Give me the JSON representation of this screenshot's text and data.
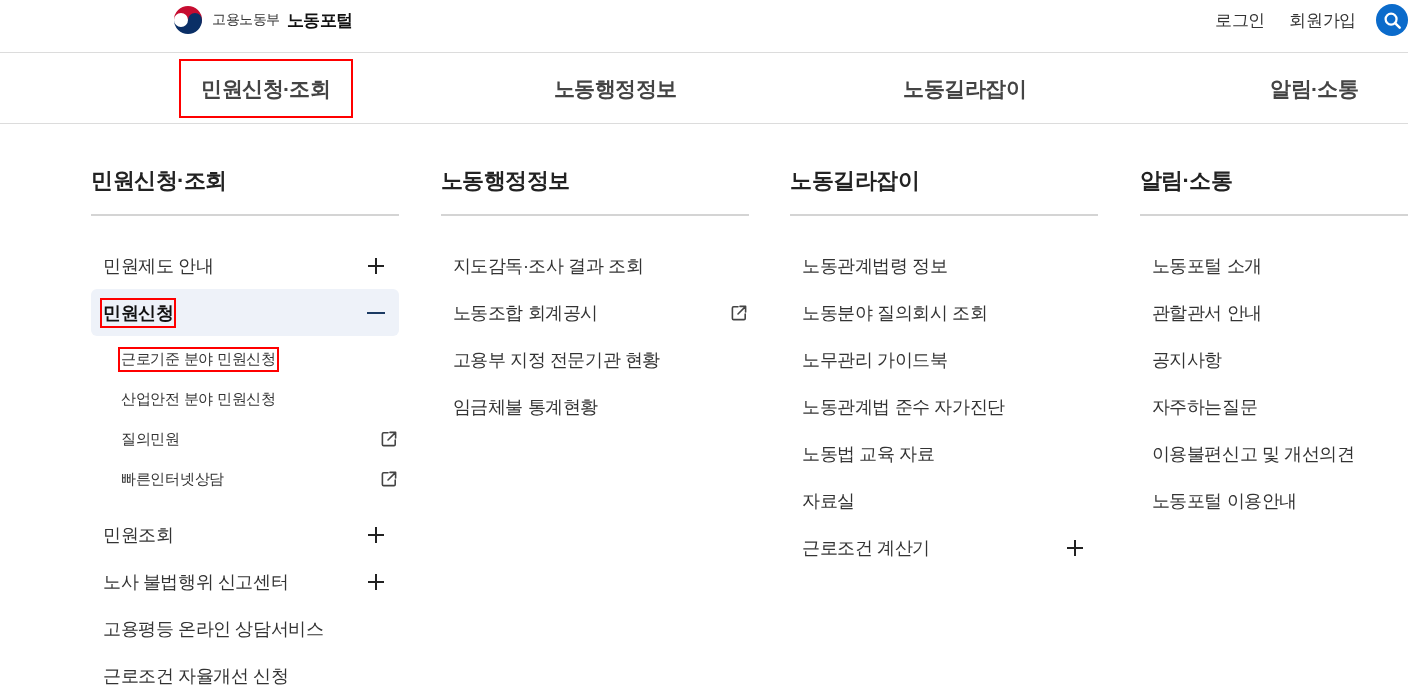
{
  "header": {
    "logo": {
      "ministry": "고용노동부",
      "portal": "노동포털"
    },
    "links": [
      "로그인",
      "회원가입"
    ]
  },
  "nav": {
    "items": [
      {
        "label": "민원신청·조회",
        "highlighted": true
      },
      {
        "label": "노동행정정보",
        "highlighted": false
      },
      {
        "label": "노동길라잡이",
        "highlighted": false
      },
      {
        "label": "알림·소통",
        "highlighted": false
      }
    ]
  },
  "menu": {
    "columns": [
      {
        "title": "민원신청·조회",
        "items": [
          {
            "label": "민원제도 안내",
            "kind": "toggle",
            "expanded": false,
            "highlighted": false
          },
          {
            "label": "민원신청",
            "kind": "toggle",
            "expanded": true,
            "highlighted": true,
            "children": [
              {
                "label": "근로기준 분야 민원신청",
                "kind": "link",
                "highlighted": true
              },
              {
                "label": "산업안전 분야 민원신청",
                "kind": "link",
                "highlighted": false
              },
              {
                "label": "질의민원",
                "kind": "external",
                "highlighted": false
              },
              {
                "label": "빠른인터넷상담",
                "kind": "external",
                "highlighted": false
              }
            ]
          },
          {
            "label": "민원조회",
            "kind": "toggle",
            "expanded": false,
            "highlighted": false
          },
          {
            "label": "노사 불법행위 신고센터",
            "kind": "toggle",
            "expanded": false,
            "highlighted": false
          },
          {
            "label": "고용평등 온라인 상담서비스",
            "kind": "link",
            "expanded": false,
            "highlighted": false
          },
          {
            "label": "근로조건 자율개선 신청",
            "kind": "link",
            "expanded": false,
            "highlighted": false
          }
        ]
      },
      {
        "title": "노동행정정보",
        "items": [
          {
            "label": "지도감독·조사 결과 조회",
            "kind": "link",
            "expanded": false,
            "highlighted": false
          },
          {
            "label": "노동조합 회계공시",
            "kind": "external",
            "expanded": false,
            "highlighted": false
          },
          {
            "label": "고용부 지정 전문기관 현황",
            "kind": "link",
            "expanded": false,
            "highlighted": false
          },
          {
            "label": "임금체불 통계현황",
            "kind": "link",
            "expanded": false,
            "highlighted": false
          }
        ]
      },
      {
        "title": "노동길라잡이",
        "items": [
          {
            "label": "노동관계법령 정보",
            "kind": "link",
            "expanded": false,
            "highlighted": false
          },
          {
            "label": "노동분야 질의회시 조회",
            "kind": "link",
            "expanded": false,
            "highlighted": false
          },
          {
            "label": "노무관리 가이드북",
            "kind": "link",
            "expanded": false,
            "highlighted": false
          },
          {
            "label": "노동관계법 준수 자가진단",
            "kind": "link",
            "expanded": false,
            "highlighted": false
          },
          {
            "label": "노동법 교육 자료",
            "kind": "link",
            "expanded": false,
            "highlighted": false
          },
          {
            "label": "자료실",
            "kind": "link",
            "expanded": false,
            "highlighted": false
          },
          {
            "label": "근로조건 계산기",
            "kind": "toggle",
            "expanded": false,
            "highlighted": false
          }
        ]
      },
      {
        "title": "알림·소통",
        "items": [
          {
            "label": "노동포털 소개",
            "kind": "link",
            "expanded": false,
            "highlighted": false
          },
          {
            "label": "관할관서 안내",
            "kind": "link",
            "expanded": false,
            "highlighted": false
          },
          {
            "label": "공지사항",
            "kind": "link",
            "expanded": false,
            "highlighted": false
          },
          {
            "label": "자주하는질문",
            "kind": "link",
            "expanded": false,
            "highlighted": false
          },
          {
            "label": "이용불편신고 및 개선의견",
            "kind": "link",
            "expanded": false,
            "highlighted": false
          },
          {
            "label": "노동포털 이용안내",
            "kind": "link",
            "expanded": false,
            "highlighted": false
          }
        ]
      }
    ]
  }
}
